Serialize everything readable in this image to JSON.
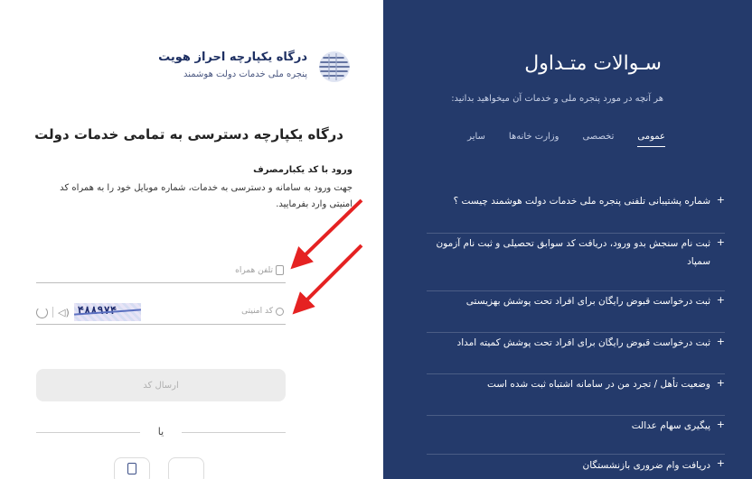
{
  "brand": {
    "title": "درگاه یکپارچه احراز هویت",
    "subtitle": "پنجره ملی خدمات دولت هوشمند",
    "logo_icon": "globe-logo-icon"
  },
  "login": {
    "main_title": "درگاه یکپارچه دسترسی به تمامی خدمات دولت",
    "section_title": "ورود با کد یکبارمصرف",
    "description": "جهت ورود به سامانه و دسترسی به خدمات، شماره موبایل خود را به همراه کد امنیتی وارد بفرمایید.",
    "phone_placeholder": "تلفن همراه",
    "captcha_placeholder": "کد امنیتی",
    "captcha_text": "۴۸۸۹۷۴",
    "send_button": "ارسال کد",
    "or_text": "یا"
  },
  "faq": {
    "title": "سـوالات متـداول",
    "subtitle": "هر آنچه در مورد پنجره ملی و خدمات آن میخواهید بدانید:",
    "tabs": [
      {
        "label": "عمومی",
        "active": true
      },
      {
        "label": "تخصصی",
        "active": false
      },
      {
        "label": "وزارت خانه‌ها",
        "active": false
      },
      {
        "label": "سایر",
        "active": false
      }
    ],
    "items": [
      "شماره پشتیبانی تلفنی پنجره ملی خدمات دولت هوشمند چیست ؟",
      "ثبت نام سنجش بدو ورود، دریافت کد سوابق تحصیلی و ثبت نام آزمون سمپاد",
      "ثبت درخواست قبوض رایگان برای افراد تحت پوشش بهزیستی",
      "ثبت درخواست قبوض رایگان برای افراد تحت پوشش کمیته امداد",
      "وضعیت تأهل / تجرد من در سامانه اشتباه ثبت شده است",
      "پیگیری سهام عدالت",
      "دریافت وام ضروری بازنشستگان"
    ]
  },
  "colors": {
    "panel_bg": "#243a6b",
    "brand": "#1d2f62",
    "arrow": "#e52222"
  }
}
